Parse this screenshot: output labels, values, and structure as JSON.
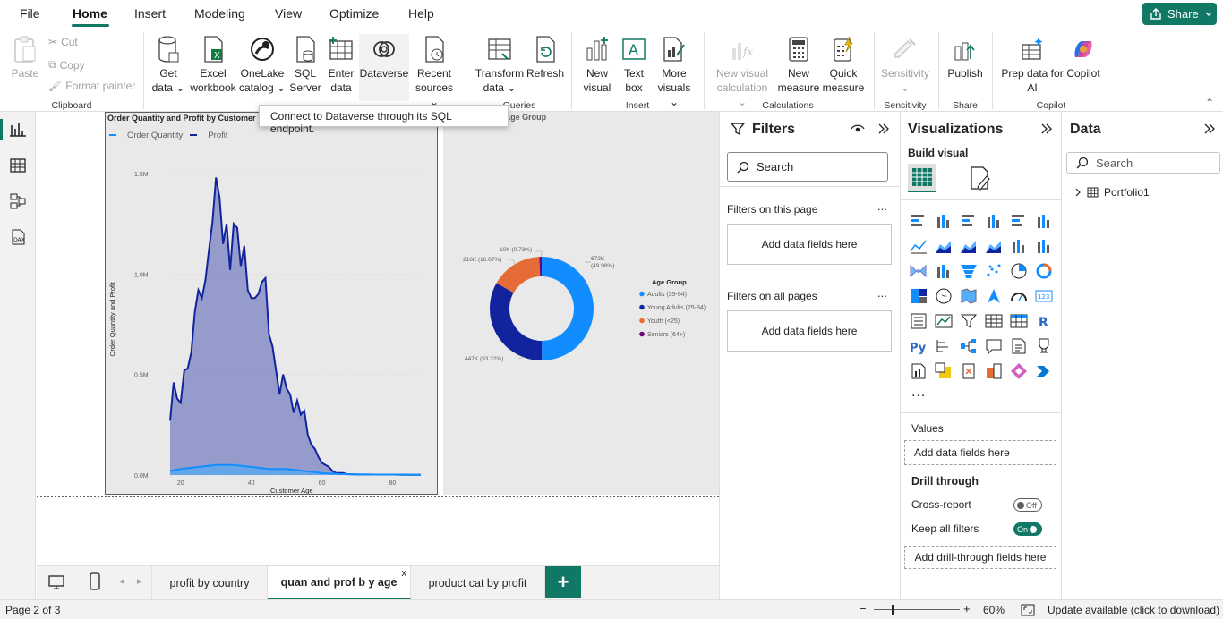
{
  "menu": {
    "items": [
      "File",
      "Home",
      "Insert",
      "Modeling",
      "View",
      "Optimize",
      "Help"
    ],
    "share_label": "Share"
  },
  "ribbon": {
    "clipboard": {
      "paste": "Paste",
      "cut": "Cut",
      "copy": "Copy",
      "format_painter": "Format painter",
      "group": "Clipboard"
    },
    "data": {
      "get_data": [
        "Get",
        "data"
      ],
      "excel": [
        "Excel",
        "workbook"
      ],
      "onelake": [
        "OneLake",
        "catalog"
      ],
      "sql": [
        "SQL",
        "Server"
      ],
      "enter": [
        "Enter",
        "data"
      ],
      "dataverse": "Dataverse",
      "recent": [
        "Recent",
        "sources"
      ],
      "group": "Da"
    },
    "queries": {
      "transform": [
        "Transform",
        "data"
      ],
      "refresh": "Refresh",
      "group": "Queries"
    },
    "insert": {
      "new_visual": [
        "New",
        "visual"
      ],
      "text_box": [
        "Text",
        "box"
      ],
      "more_visuals": [
        "More",
        "visuals"
      ],
      "group": "Insert"
    },
    "calculations": {
      "new_visual_calc": [
        "New visual",
        "calculation"
      ],
      "new_measure": [
        "New",
        "measure"
      ],
      "quick_measure": [
        "Quick",
        "measure"
      ],
      "group": "Calculations"
    },
    "sensitivity": {
      "label": "Sensitivity",
      "group": "Sensitivity"
    },
    "share": {
      "publish": "Publish",
      "group": "Share"
    },
    "copilot": {
      "prep": [
        "Prep data for",
        "AI"
      ],
      "copilot": "Copilot",
      "group": "Copilot"
    }
  },
  "tooltip": "Connect to Dataverse through its SQL endpoint.",
  "area_chart_header": {
    "title": "Order Quantity and Profit by Customer",
    "legend": [
      "Order Quantity",
      "Profit"
    ]
  },
  "donut_chart_header": {
    "title_fragment": "by Age Group"
  },
  "chart_data": [
    {
      "type": "area",
      "title": "Order Quantity and Profit by Customer",
      "xlabel": "Customer Age",
      "ylabel": "Order Quantity and Profit",
      "x_ticks": [
        "20",
        "40",
        "60",
        "80"
      ],
      "y_ticks": [
        "0.0M",
        "0.5M",
        "1.0M",
        "1.5M"
      ],
      "xlim": [
        17,
        88
      ],
      "ylim": [
        0,
        1.58
      ],
      "legend_position": "top-left",
      "series": [
        {
          "name": "Order Quantity",
          "color": "#118dff",
          "x": [
            17,
            20,
            25,
            30,
            35,
            40,
            45,
            50,
            55,
            60,
            65,
            70,
            75,
            80,
            88
          ],
          "y": [
            0.02,
            0.03,
            0.04,
            0.05,
            0.05,
            0.04,
            0.03,
            0.03,
            0.02,
            0.01,
            0.005,
            0.003,
            0.002,
            0.002,
            0.001
          ]
        },
        {
          "name": "Profit",
          "color": "#12239e",
          "x": [
            17,
            18,
            19,
            20,
            21,
            22,
            23,
            24,
            25,
            26,
            27,
            28,
            29,
            30,
            31,
            32,
            33,
            34,
            35,
            36,
            37,
            38,
            39,
            40,
            41,
            42,
            43,
            44,
            45,
            46,
            47,
            48,
            49,
            50,
            51,
            52,
            53,
            54,
            55,
            56,
            57,
            58,
            59,
            60,
            61,
            62,
            63,
            64,
            65,
            66,
            67,
            68,
            70,
            72,
            75,
            78,
            80,
            83,
            85,
            88
          ],
          "y": [
            0.27,
            0.46,
            0.38,
            0.36,
            0.52,
            0.53,
            0.61,
            0.81,
            0.92,
            0.88,
            0.97,
            1.12,
            1.26,
            1.48,
            1.38,
            1.15,
            1.25,
            1.02,
            1.25,
            1.23,
            1.04,
            1.14,
            0.92,
            0.88,
            0.88,
            0.9,
            0.96,
            0.98,
            0.7,
            0.64,
            0.52,
            0.4,
            0.5,
            0.43,
            0.4,
            0.31,
            0.37,
            0.3,
            0.32,
            0.2,
            0.15,
            0.13,
            0.09,
            0.06,
            0.05,
            0.04,
            0.02,
            0.01,
            0.01,
            0.01,
            0.005,
            0.004,
            0.003,
            0.003,
            0.002,
            0.002,
            0.002,
            0.001,
            0.001,
            0.001
          ]
        }
      ]
    },
    {
      "type": "pie",
      "title": "by Age Group",
      "legend_title": "Age Group",
      "legend_position": "right",
      "slices": [
        {
          "name": "Adults (35-64)",
          "value": 672,
          "label": "672K (49.98%)",
          "pct": 49.98,
          "color": "#118dff"
        },
        {
          "name": "Young Adults (25-34)",
          "value": 447,
          "label": "447K (33.22%)",
          "pct": 33.22,
          "color": "#12239e"
        },
        {
          "name": "Youth (<25)",
          "value": 216,
          "label": "216K (16.07%)",
          "pct": 16.07,
          "color": "#e66c37"
        },
        {
          "name": "Seniors (64+)",
          "value": 10,
          "label": "10K (0.73%)",
          "pct": 0.73,
          "color": "#6b007b"
        }
      ]
    }
  ],
  "page_tabs": [
    "profit by country",
    "quan and prof b y age",
    "product cat by profit"
  ],
  "active_tab": 1,
  "status": {
    "page": "Page 2 of 3",
    "zoom": "60%",
    "update": "Update available (click to download)"
  },
  "filters": {
    "title": "Filters",
    "search": "Search",
    "on_this_page": "Filters on this page",
    "on_all_pages": "Filters on all pages",
    "add_fields": "Add data fields here",
    "more": "..."
  },
  "visualizations": {
    "title": "Visualizations",
    "build_visual": "Build visual",
    "values": "Values",
    "add_fields": "Add data fields here",
    "drill_through": "Drill through",
    "cross_report": "Cross-report",
    "cross_report_state": "Off",
    "keep_all_filters": "Keep all filters",
    "keep_all_state": "On",
    "add_drill": "Add drill-through fields here",
    "more_icons": "..."
  },
  "data_pane": {
    "title": "Data",
    "search": "Search",
    "tables": [
      "Portfolio1"
    ]
  },
  "colors": {
    "accent": "#117865",
    "blue": "#118dff",
    "navy": "#12239e",
    "orange": "#e66c37",
    "purple": "#6b007b"
  }
}
